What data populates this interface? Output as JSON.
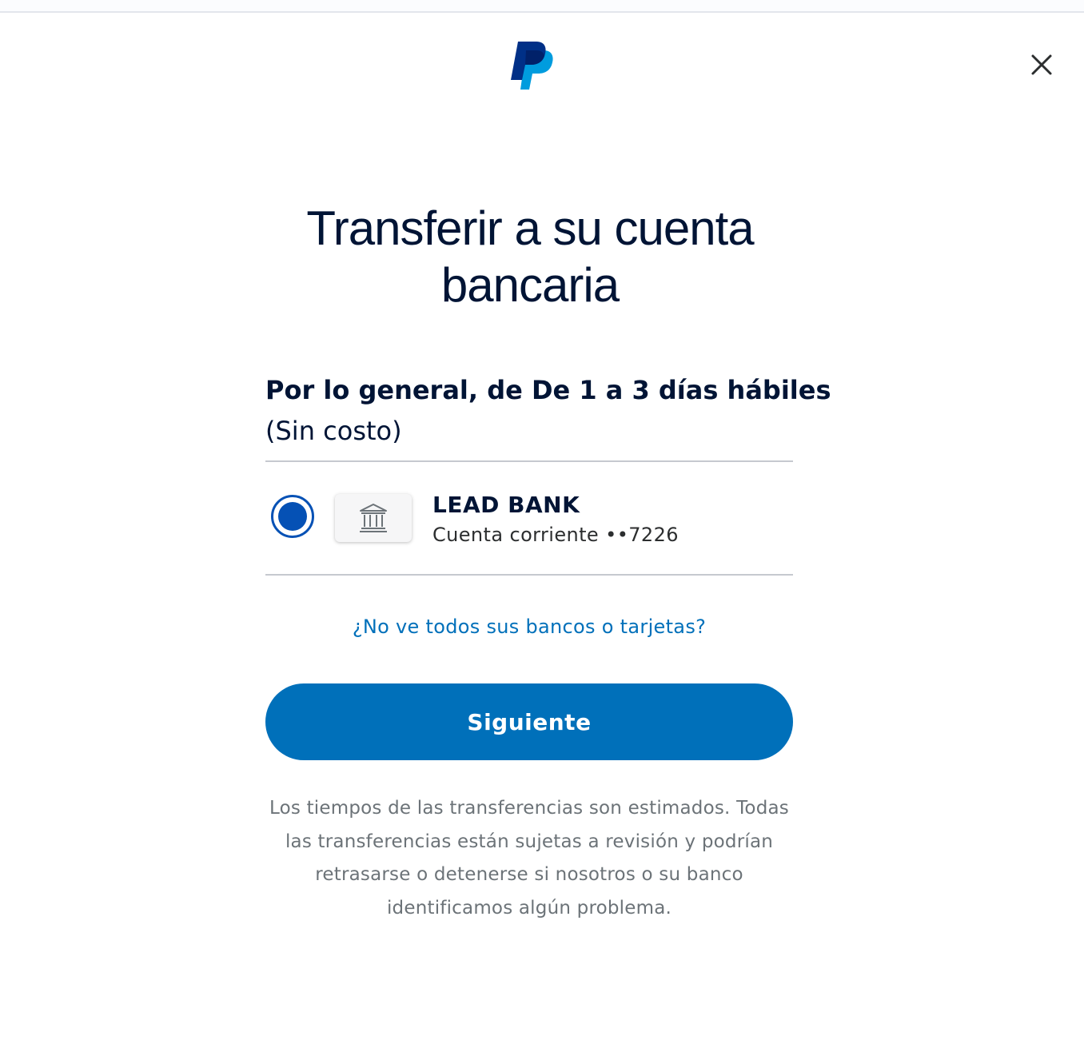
{
  "header": {
    "logo_icon": "paypal-logo-icon",
    "close_icon": "close-icon"
  },
  "title": "Transferir a su cuenta bancaria",
  "transfer_speed": "Por lo general, de De 1 a 3 días hábiles",
  "transfer_fee": "(Sin costo)",
  "bank": {
    "name": "LEAD BANK",
    "account": "Cuenta corriente ••7226",
    "icon": "bank-icon",
    "selected": true
  },
  "missing_banks_link": "¿No ve todos sus bancos o tarjetas?",
  "next_button": "Siguiente",
  "disclaimer": "Los tiempos de las transferencias son estimados. Todas las transferencias están sujetas a revisión y podrían retrasarse o detenerse si nosotros o su banco identificamos algún problema.",
  "colors": {
    "primary": "#0070ba",
    "radio": "#0551b5",
    "heading": "#001435",
    "muted": "#6c7378",
    "logo_dark": "#003087",
    "logo_light": "#009cde"
  }
}
